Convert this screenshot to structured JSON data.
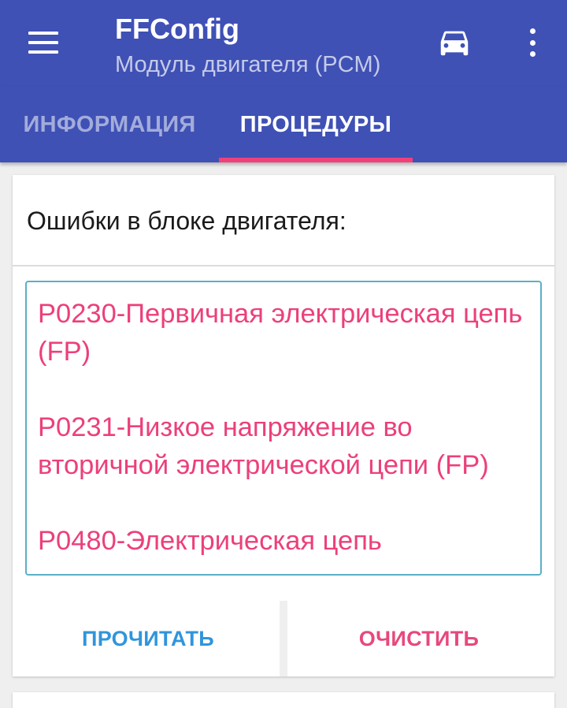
{
  "appbar": {
    "title": "FFConfig",
    "subtitle": "Модуль двигателя (PCM)",
    "menu_icon": "hamburger-menu-icon",
    "car_icon": "car-icon",
    "more_icon": "more-vert-icon"
  },
  "tabs": [
    {
      "label": "ИНФОРМАЦИЯ",
      "selected": false
    },
    {
      "label": "ПРОЦЕДУРЫ",
      "selected": true
    }
  ],
  "errors_card": {
    "title": "Ошибки в блоке двигателя:",
    "errors": [
      "P0230-Первичная электрическая цепь (FP)",
      "P0231-Низкое напряжение во вторичной электрической цепи (FP)",
      "P0480-Электрическая цепь"
    ],
    "read_button": "ПРОЧИТАТЬ",
    "clear_button": "ОЧИСТИТЬ"
  },
  "colors": {
    "primary": "#3f51b5",
    "accent": "#f0407a",
    "error_text": "#ec407a",
    "read_button": "#2f95dc",
    "clear_button": "#e8487c"
  }
}
